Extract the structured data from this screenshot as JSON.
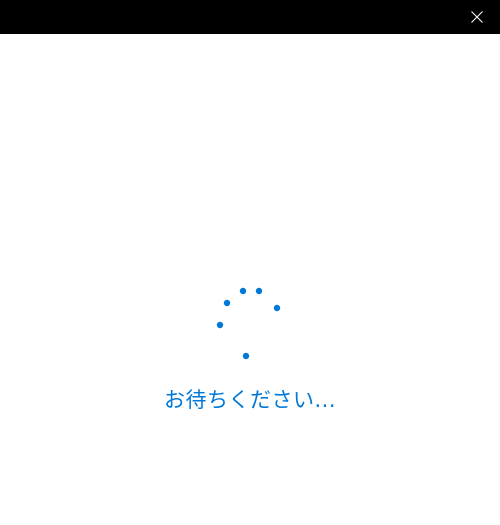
{
  "window": {
    "close_icon": "close-icon"
  },
  "loading": {
    "message": "お待ちください...",
    "accent_color": "#0078d7",
    "spinner_icon": "progress-ring-dots"
  },
  "colors": {
    "titlebar": "#000000",
    "background": "#ffffff",
    "close_glyph": "#ffffff"
  }
}
